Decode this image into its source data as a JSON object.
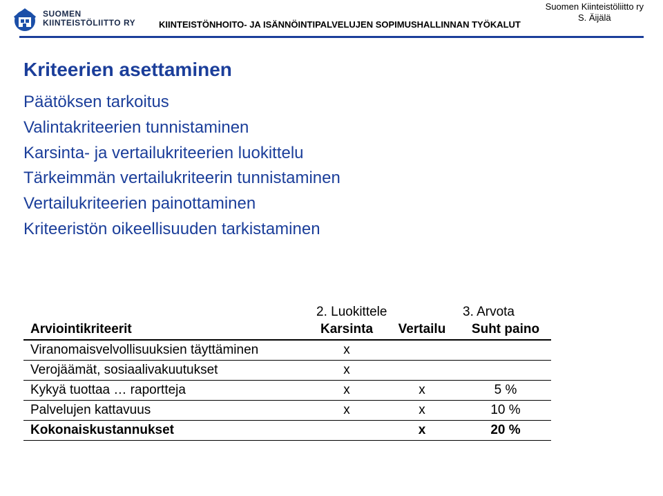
{
  "header": {
    "logo_line1": "SUOMEN",
    "logo_line2": "KIINTEISTÖLIITTO RY",
    "title": "KIINTEISTÖNHOITO- JA ISÄNNÖINTIPALVELUJEN SOPIMUSHALLINNAN TYÖKALUT",
    "right_line1": "Suomen Kiinteistöliitto ry",
    "right_line2": "S. Äijälä"
  },
  "content": {
    "title": "Kriteerien asettaminen",
    "bullets": [
      "Päätöksen tarkoitus",
      "Valintakriteerien tunnistaminen",
      "Karsinta- ja vertailukriteerien luokittelu",
      "Tärkeimmän vertailukriteerin tunnistaminen",
      "Vertailukriteerien painottaminen",
      "Kriteeristön oikeellisuuden tarkistaminen"
    ]
  },
  "table": {
    "top_labels": {
      "col2": "2. Luokittele",
      "col3": "3. Arvota"
    },
    "headers": {
      "criteria": "Arviointikriteerit",
      "karsinta": "Karsinta",
      "vertailu": "Vertailu",
      "paino": "Suht paino"
    },
    "rows": [
      {
        "criteria": "Viranomaisvelvollisuuksien täyttäminen",
        "karsinta": "x",
        "vertailu": "",
        "paino": ""
      },
      {
        "criteria": "Verojäämät, sosiaalivakuutukset",
        "karsinta": "x",
        "vertailu": "",
        "paino": ""
      },
      {
        "criteria": "Kykyä tuottaa … raportteja",
        "karsinta": "x",
        "vertailu": "x",
        "paino": "5 %"
      },
      {
        "criteria": "Palvelujen kattavuus",
        "karsinta": "x",
        "vertailu": "x",
        "paino": "10 %"
      },
      {
        "criteria": "Kokonaiskustannukset",
        "karsinta": "",
        "vertailu": "x",
        "paino": "20 %",
        "bold": true
      }
    ]
  }
}
